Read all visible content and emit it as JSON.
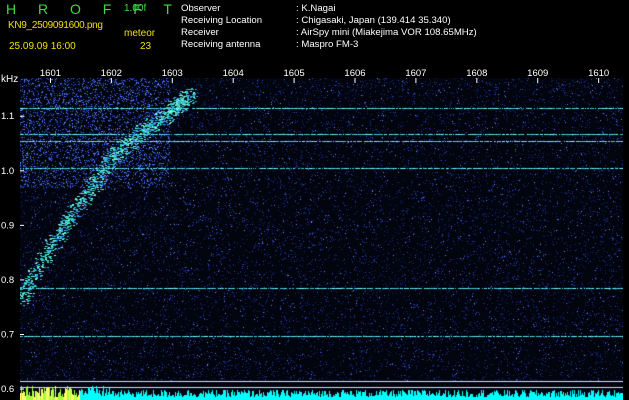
{
  "header": {
    "brand": "H R O F F T",
    "version": "1.00f",
    "filename": "KN9_2509091600.png",
    "meteor_label": "meteor",
    "datetime": "25.09.09 16:00",
    "meteor_count": "23"
  },
  "info": [
    {
      "label": "Observer",
      "value": ": K.Nagai"
    },
    {
      "label": "Receiving Location",
      "value": ": Chigasaki, Japan (139.414 35.340)"
    },
    {
      "label": "Receiver",
      "value": ": AirSpy mini (Miakejima VOR 108.65MHz)"
    },
    {
      "label": "Receiving antenna",
      "value": ": Maspro FM-3"
    }
  ],
  "chart_data": {
    "type": "heatmap",
    "xlabel": "",
    "ylabel": "kHz",
    "x_ticks": [
      "1601",
      "1602",
      "1603",
      "1604",
      "1605",
      "1606",
      "1607",
      "1608",
      "1609",
      "1610"
    ],
    "y_ticks": [
      "1.1",
      "1.0",
      "0.9",
      "0.8",
      "0.7",
      "0.6"
    ],
    "xlim": [
      1600.5,
      1610.4
    ],
    "ylim": [
      0.58,
      1.17
    ],
    "constant_lines_khz": [
      1.115,
      1.068,
      1.055,
      1.005,
      0.785,
      0.698,
      0.615,
      0.603
    ],
    "meteor_streak": {
      "x": [
        1600.5,
        1601.0,
        1601.5,
        1602.0,
        1602.5,
        1603.0,
        1603.3
      ],
      "y": [
        0.76,
        0.86,
        0.94,
        1.02,
        1.07,
        1.11,
        1.14
      ]
    },
    "colors": {
      "background": "#02040e",
      "noise": "#2a4ad0",
      "line": "#50e0e0",
      "bar_low": "#ffff60",
      "bar_high": "#00ffff"
    },
    "grid": false
  }
}
